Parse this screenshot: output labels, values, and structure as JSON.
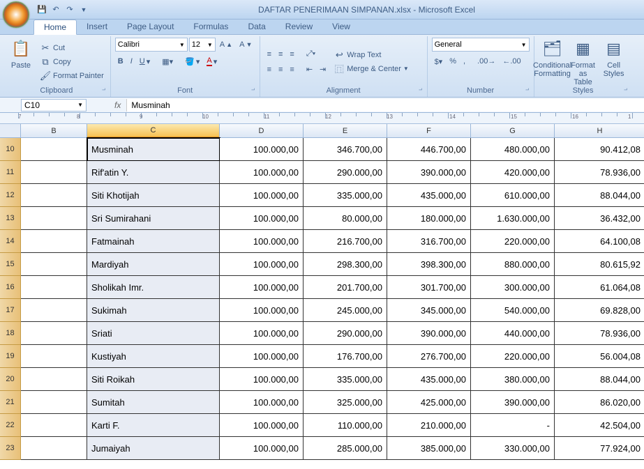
{
  "app": {
    "title": "DAFTAR PENERIMAAN SIMPANAN.xlsx - Microsoft Excel"
  },
  "tabs": [
    "Home",
    "Insert",
    "Page Layout",
    "Formulas",
    "Data",
    "Review",
    "View"
  ],
  "activeTab": "Home",
  "ribbon": {
    "clipboard": {
      "label": "Clipboard",
      "paste": "Paste",
      "cut": "Cut",
      "copy": "Copy",
      "fp": "Format Painter"
    },
    "font": {
      "label": "Font",
      "name": "Calibri",
      "size": "12"
    },
    "alignment": {
      "label": "Alignment",
      "wrap": "Wrap Text",
      "merge": "Merge & Center"
    },
    "number": {
      "label": "Number",
      "format": "General"
    },
    "styles": {
      "label": "Styles",
      "cf": "Conditional\nFormatting",
      "fat": "Format\nas Table",
      "cs": "Cell\nStyles"
    }
  },
  "namebox": "C10",
  "fx_label": "fx",
  "formula": "Musminah",
  "columns": [
    "B",
    "C",
    "D",
    "E",
    "F",
    "G",
    "H"
  ],
  "selectedCol": "C",
  "ruler_nums": [
    "7",
    "8",
    "9",
    "10",
    "11",
    "12",
    "13",
    "14",
    "15",
    "16",
    "1"
  ],
  "rows": [
    {
      "n": "10",
      "name": "Musminah",
      "d": "100.000,00",
      "e": "346.700,00",
      "f": "446.700,00",
      "g": "480.000,00",
      "h": "90.412,08"
    },
    {
      "n": "11",
      "name": "Rif'atin Y.",
      "d": "100.000,00",
      "e": "290.000,00",
      "f": "390.000,00",
      "g": "420.000,00",
      "h": "78.936,00"
    },
    {
      "n": "12",
      "name": "Siti Khotijah",
      "d": "100.000,00",
      "e": "335.000,00",
      "f": "435.000,00",
      "g": "610.000,00",
      "h": "88.044,00"
    },
    {
      "n": "13",
      "name": "Sri Sumirahani",
      "d": "100.000,00",
      "e": "80.000,00",
      "f": "180.000,00",
      "g": "1.630.000,00",
      "h": "36.432,00"
    },
    {
      "n": "14",
      "name": "Fatmainah",
      "d": "100.000,00",
      "e": "216.700,00",
      "f": "316.700,00",
      "g": "220.000,00",
      "h": "64.100,08"
    },
    {
      "n": "15",
      "name": "Mardiyah",
      "d": "100.000,00",
      "e": "298.300,00",
      "f": "398.300,00",
      "g": "880.000,00",
      "h": "80.615,92"
    },
    {
      "n": "16",
      "name": "Sholikah Imr.",
      "d": "100.000,00",
      "e": "201.700,00",
      "f": "301.700,00",
      "g": "300.000,00",
      "h": "61.064,08"
    },
    {
      "n": "17",
      "name": "Sukimah",
      "d": "100.000,00",
      "e": "245.000,00",
      "f": "345.000,00",
      "g": "540.000,00",
      "h": "69.828,00"
    },
    {
      "n": "18",
      "name": "Sriati",
      "d": "100.000,00",
      "e": "290.000,00",
      "f": "390.000,00",
      "g": "440.000,00",
      "h": "78.936,00"
    },
    {
      "n": "19",
      "name": "Kustiyah",
      "d": "100.000,00",
      "e": "176.700,00",
      "f": "276.700,00",
      "g": "220.000,00",
      "h": "56.004,08"
    },
    {
      "n": "20",
      "name": "Siti Roikah",
      "d": "100.000,00",
      "e": "335.000,00",
      "f": "435.000,00",
      "g": "380.000,00",
      "h": "88.044,00"
    },
    {
      "n": "21",
      "name": "Sumitah",
      "d": "100.000,00",
      "e": "325.000,00",
      "f": "425.000,00",
      "g": "390.000,00",
      "h": "86.020,00"
    },
    {
      "n": "22",
      "name": "Karti F.",
      "d": "100.000,00",
      "e": "110.000,00",
      "f": "210.000,00",
      "g": "-",
      "h": "42.504,00"
    },
    {
      "n": "23",
      "name": "Jumaiyah",
      "d": "100.000,00",
      "e": "285.000,00",
      "f": "385.000,00",
      "g": "330.000,00",
      "h": "77.924,00"
    }
  ],
  "selectedRow": "10"
}
